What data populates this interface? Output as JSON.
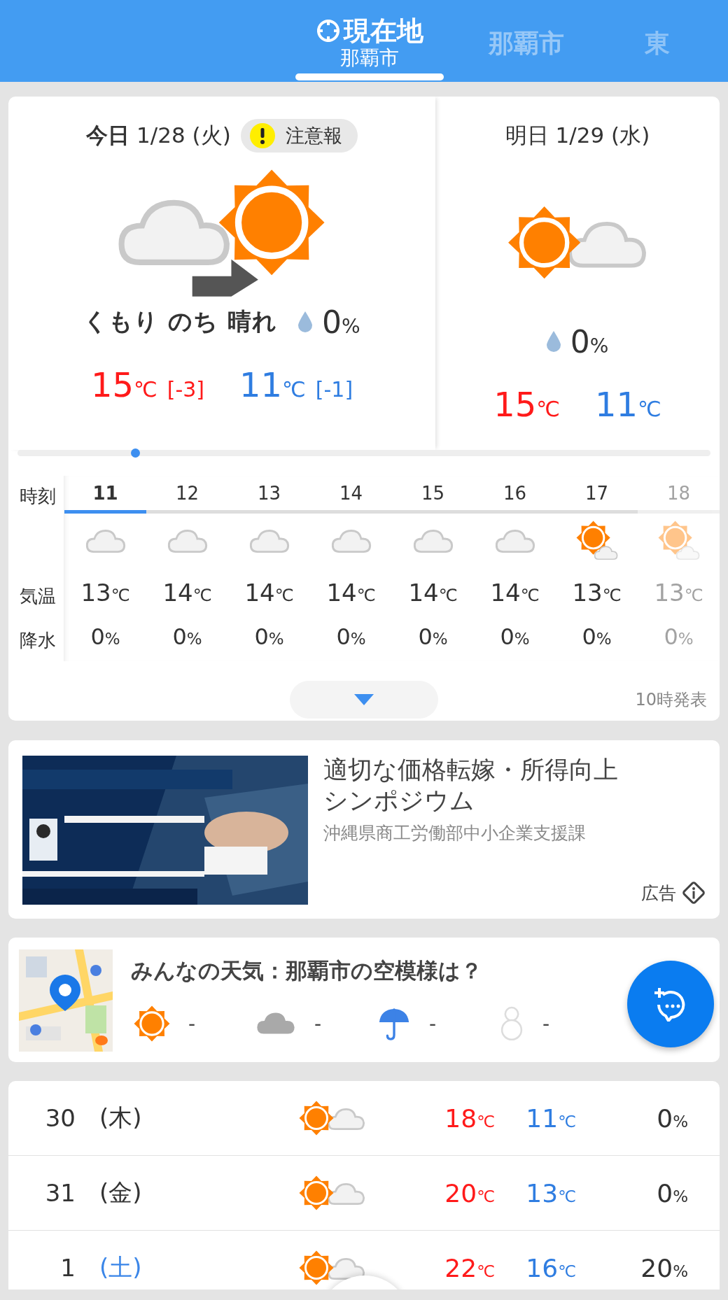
{
  "header": {
    "tabs": [
      {
        "kind": "location",
        "label": "現在地",
        "sublabel": "那覇市",
        "selected": true
      },
      {
        "kind": "city",
        "label": "那覇市",
        "selected": false
      },
      {
        "kind": "city",
        "label": "東",
        "selected": false
      }
    ]
  },
  "today": {
    "day": "今日",
    "date": "1/28 (火)",
    "alert": "注意報",
    "kind": "cloudy_then_sunny",
    "weather": "くもり のち 晴れ",
    "precip": {
      "value": "0",
      "unit": "%"
    },
    "high": {
      "value": "15",
      "unit": "℃",
      "diff": "[-3]"
    },
    "low": {
      "value": "11",
      "unit": "℃",
      "diff": "[-1]"
    }
  },
  "tomorrow": {
    "day": "明日",
    "date": "1/29 (水)",
    "kind": "sunny_cloudy",
    "precip": {
      "value": "0",
      "unit": "%"
    },
    "high": {
      "value": "15",
      "unit": "℃"
    },
    "low": {
      "value": "11",
      "unit": "℃"
    }
  },
  "timeline": {
    "level": 0.17
  },
  "hourly": {
    "row_labels": [
      "時刻",
      "気温",
      "降水"
    ],
    "issued": "10時発表",
    "hours": [
      {
        "hour": "11",
        "kind": "cloudy",
        "temp": {
          "value": "13",
          "unit": "℃"
        },
        "precip": {
          "value": "0",
          "unit": "%"
        },
        "selected": true
      },
      {
        "hour": "12",
        "kind": "cloudy",
        "temp": {
          "value": "14",
          "unit": "℃"
        },
        "precip": {
          "value": "0",
          "unit": "%"
        },
        "selected": false
      },
      {
        "hour": "13",
        "kind": "cloudy",
        "temp": {
          "value": "14",
          "unit": "℃"
        },
        "precip": {
          "value": "0",
          "unit": "%"
        },
        "selected": false
      },
      {
        "hour": "14",
        "kind": "cloudy",
        "temp": {
          "value": "14",
          "unit": "℃"
        },
        "precip": {
          "value": "0",
          "unit": "%"
        },
        "selected": false
      },
      {
        "hour": "15",
        "kind": "cloudy",
        "temp": {
          "value": "14",
          "unit": "℃"
        },
        "precip": {
          "value": "0",
          "unit": "%"
        },
        "selected": false
      },
      {
        "hour": "16",
        "kind": "cloudy",
        "temp": {
          "value": "14",
          "unit": "℃"
        },
        "precip": {
          "value": "0",
          "unit": "%"
        },
        "selected": false
      },
      {
        "hour": "17",
        "kind": "sunny_small_cloud",
        "temp": {
          "value": "13",
          "unit": "℃"
        },
        "precip": {
          "value": "0",
          "unit": "%"
        },
        "selected": false
      },
      {
        "hour": "18",
        "kind": "sunny_small_cloud",
        "temp": {
          "value": "13",
          "unit": "℃"
        },
        "precip": {
          "value": "0",
          "unit": "%"
        },
        "selected": false
      }
    ]
  },
  "ad": {
    "title": "適切な価格転嫁・所得向上シンポジウム",
    "sponsor": "沖縄県商工労働部中小企業支援課",
    "label": "広告"
  },
  "community": {
    "title": "みんなの天気：那覇市の空模様は？",
    "votes": [
      {
        "kind": "sunny",
        "count": "-"
      },
      {
        "kind": "cloudy",
        "count": "-"
      },
      {
        "kind": "rain",
        "count": "-"
      },
      {
        "kind": "snow",
        "count": "-"
      }
    ]
  },
  "forecast": [
    {
      "day": "30",
      "weekday": "(木)",
      "color": "#333333",
      "kind": "sunny_cloudy",
      "high": {
        "value": "18",
        "unit": "℃"
      },
      "low": {
        "value": "11",
        "unit": "℃"
      },
      "precip": {
        "value": "0",
        "unit": "%"
      }
    },
    {
      "day": "31",
      "weekday": "(金)",
      "color": "#333333",
      "kind": "sunny_cloudy",
      "high": {
        "value": "20",
        "unit": "℃"
      },
      "low": {
        "value": "13",
        "unit": "℃"
      },
      "precip": {
        "value": "0",
        "unit": "%"
      }
    },
    {
      "day": "1",
      "weekday": "(土)",
      "color": "#3b86e8",
      "kind": "sunny_cloudy",
      "high": {
        "value": "22",
        "unit": "℃"
      },
      "low": {
        "value": "16",
        "unit": "℃"
      },
      "precip": {
        "value": "20",
        "unit": "%"
      }
    }
  ]
}
